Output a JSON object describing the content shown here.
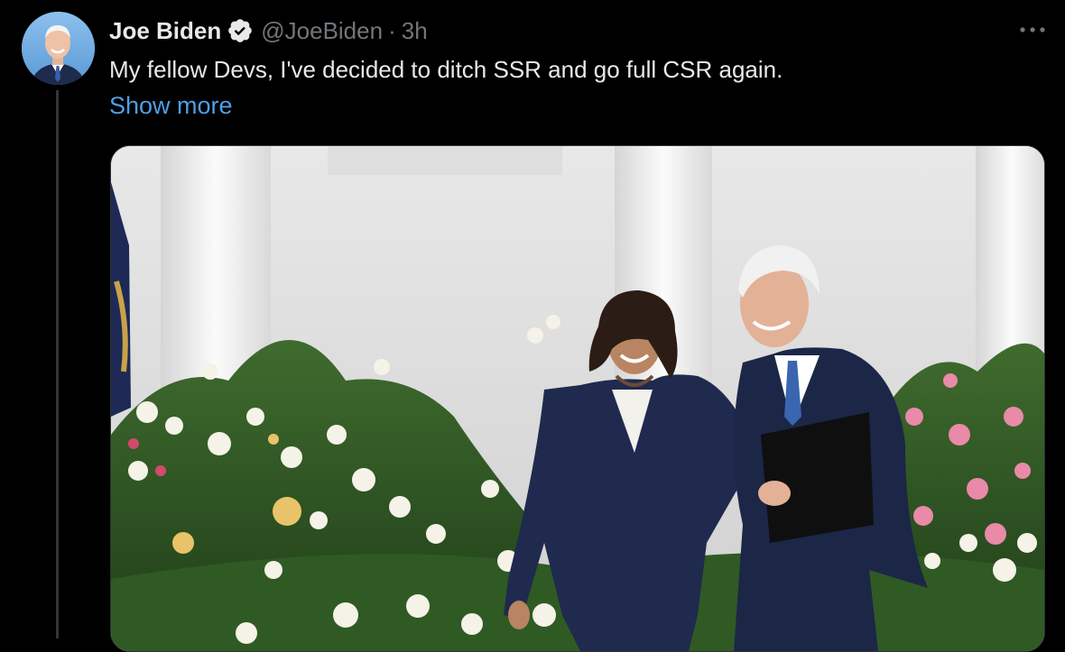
{
  "tweet": {
    "author": {
      "display_name": "Joe Biden",
      "handle": "@JoeBiden",
      "verified": true,
      "avatar_icon": "profile-photo"
    },
    "separator": "·",
    "time": "3h",
    "text": "My fellow Devs, I've decided to ditch SSR and go full CSR again.",
    "show_more_label": "Show more",
    "more_icon": "more-horizontal-icon",
    "media": {
      "type": "photo",
      "alt_description": "photo"
    }
  },
  "colors": {
    "background": "#000000",
    "text_primary": "#e7e9ea",
    "text_secondary": "#71767b",
    "link": "#4c9fe6",
    "verified_badge": "#e7e9ea",
    "thread_line": "#333639"
  }
}
